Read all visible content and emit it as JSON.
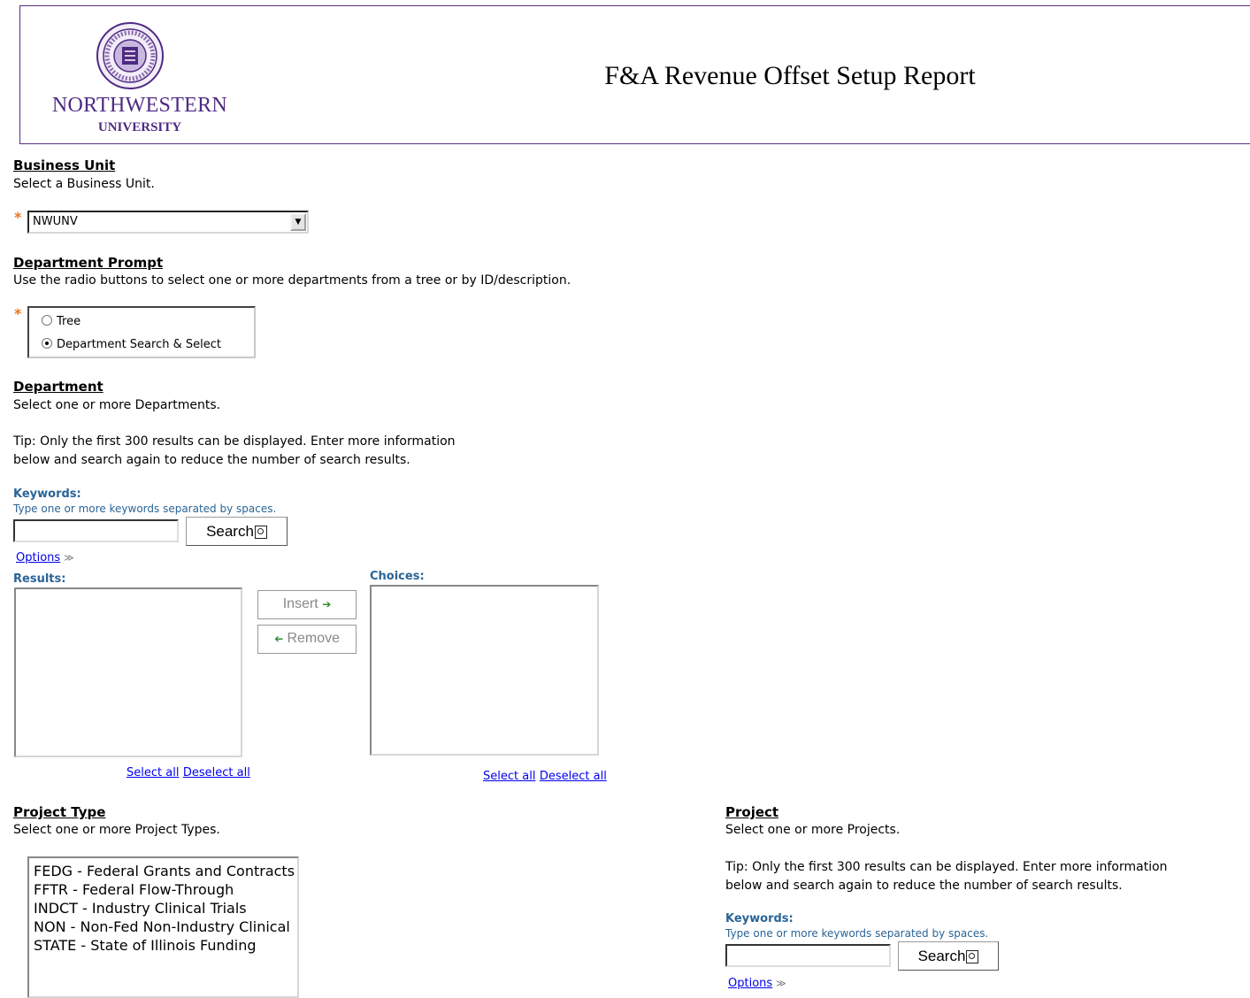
{
  "header": {
    "logo_name": "NORTHWESTERN",
    "logo_sub": "UNIVERSITY",
    "report_title": "F&A Revenue Offset Setup Report"
  },
  "business_unit": {
    "title": "Business Unit",
    "description": "Select a Business Unit.",
    "required_marker": "*",
    "selected_value": "NWUNV",
    "dropdown_icon": "chevron-down-icon"
  },
  "department_prompt": {
    "title": "Department Prompt",
    "description": "Use the radio buttons to select one or more departments from a tree or by ID/description.",
    "required_marker": "*",
    "options": [
      {
        "label": "Tree",
        "selected": false
      },
      {
        "label": "Department Search & Select",
        "selected": true
      }
    ]
  },
  "department": {
    "title": "Department",
    "description": "Select one or more Departments.",
    "tip_line1": "Tip: Only the first 300 results can be displayed. Enter more information",
    "tip_line2": "below and search again to reduce the number of search results.",
    "keywords_label": "Keywords:",
    "keywords_hint": "Type one or more keywords separated by spaces.",
    "keywords_value": "",
    "search_button": "Search",
    "options_link": "Options",
    "results_label": "Results:",
    "choices_label": "Choices:",
    "insert_button": "Insert",
    "remove_button": "Remove",
    "select_all": "Select all",
    "deselect_all": "Deselect all"
  },
  "project_type": {
    "title": "Project Type",
    "description": "Select one or more Project Types.",
    "items": [
      "FEDG - Federal Grants and Contracts",
      "FFTR - Federal Flow-Through",
      "INDCT - Industry Clinical Trials",
      "NON - Non-Fed Non-Industry Clinical",
      "STATE - State of Illinois Funding"
    ]
  },
  "project": {
    "title": "Project",
    "description": "Select one or more Projects.",
    "tip_line1": "Tip: Only the first 300 results can be displayed. Enter more information",
    "tip_line2": "below and search again to reduce the number of search results.",
    "keywords_label": "Keywords:",
    "keywords_hint": "Type one or more keywords separated by spaces.",
    "keywords_value": "",
    "search_button": "Search",
    "options_link": "Options"
  },
  "colors": {
    "brand_purple": "#4e2a84",
    "required_orange": "#e8761e",
    "label_blue": "#2a6496",
    "link_blue": "#0000ee"
  }
}
